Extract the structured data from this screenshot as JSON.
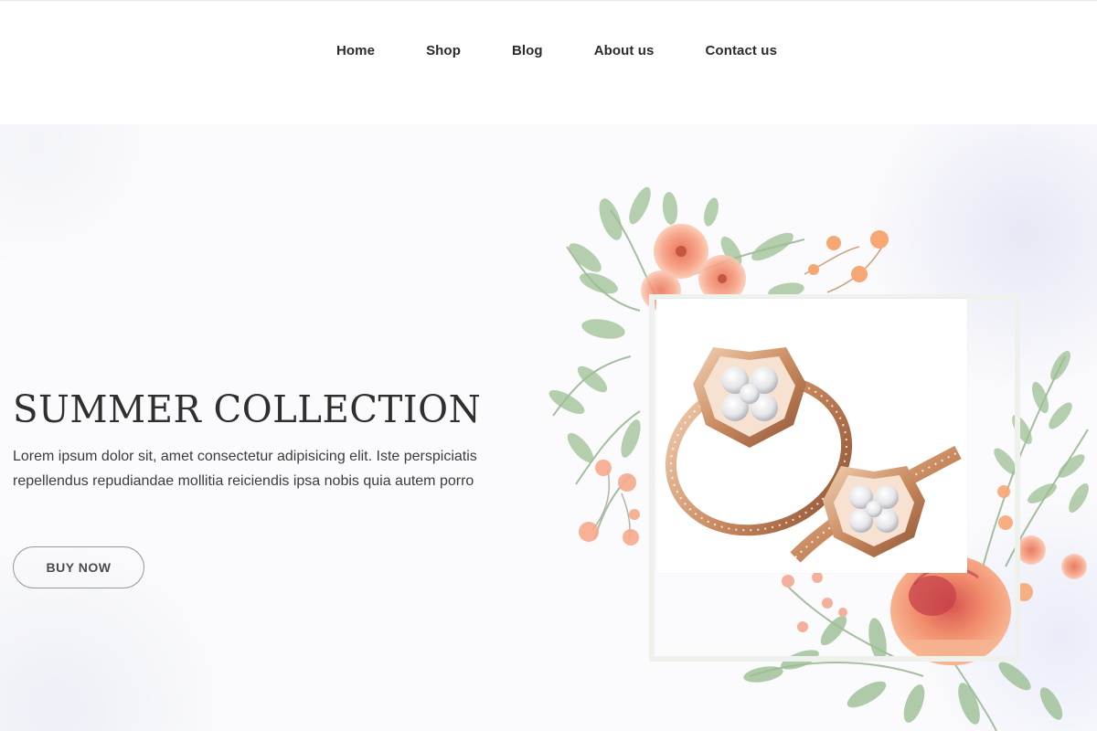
{
  "nav": {
    "items": [
      "Home",
      "Shop",
      "Blog",
      "About us",
      "Contact us"
    ]
  },
  "hero": {
    "title": "SUMMER COLLECTION",
    "description": "Lorem ipsum dolor sit, amet consectetur adipisicing elit. Iste perspiciatis repellendus repudiandae mollitia reiciendis ipsa nobis quia autem porro",
    "cta_label": "BUY NOW"
  },
  "colors": {
    "text_dark": "#2b2b2b",
    "gold": "#c9956e",
    "peach": "#f4a07e",
    "leaf": "#9dbf94"
  },
  "icons": [
    "floral-wreath-illustration",
    "diamond-ring-image"
  ]
}
